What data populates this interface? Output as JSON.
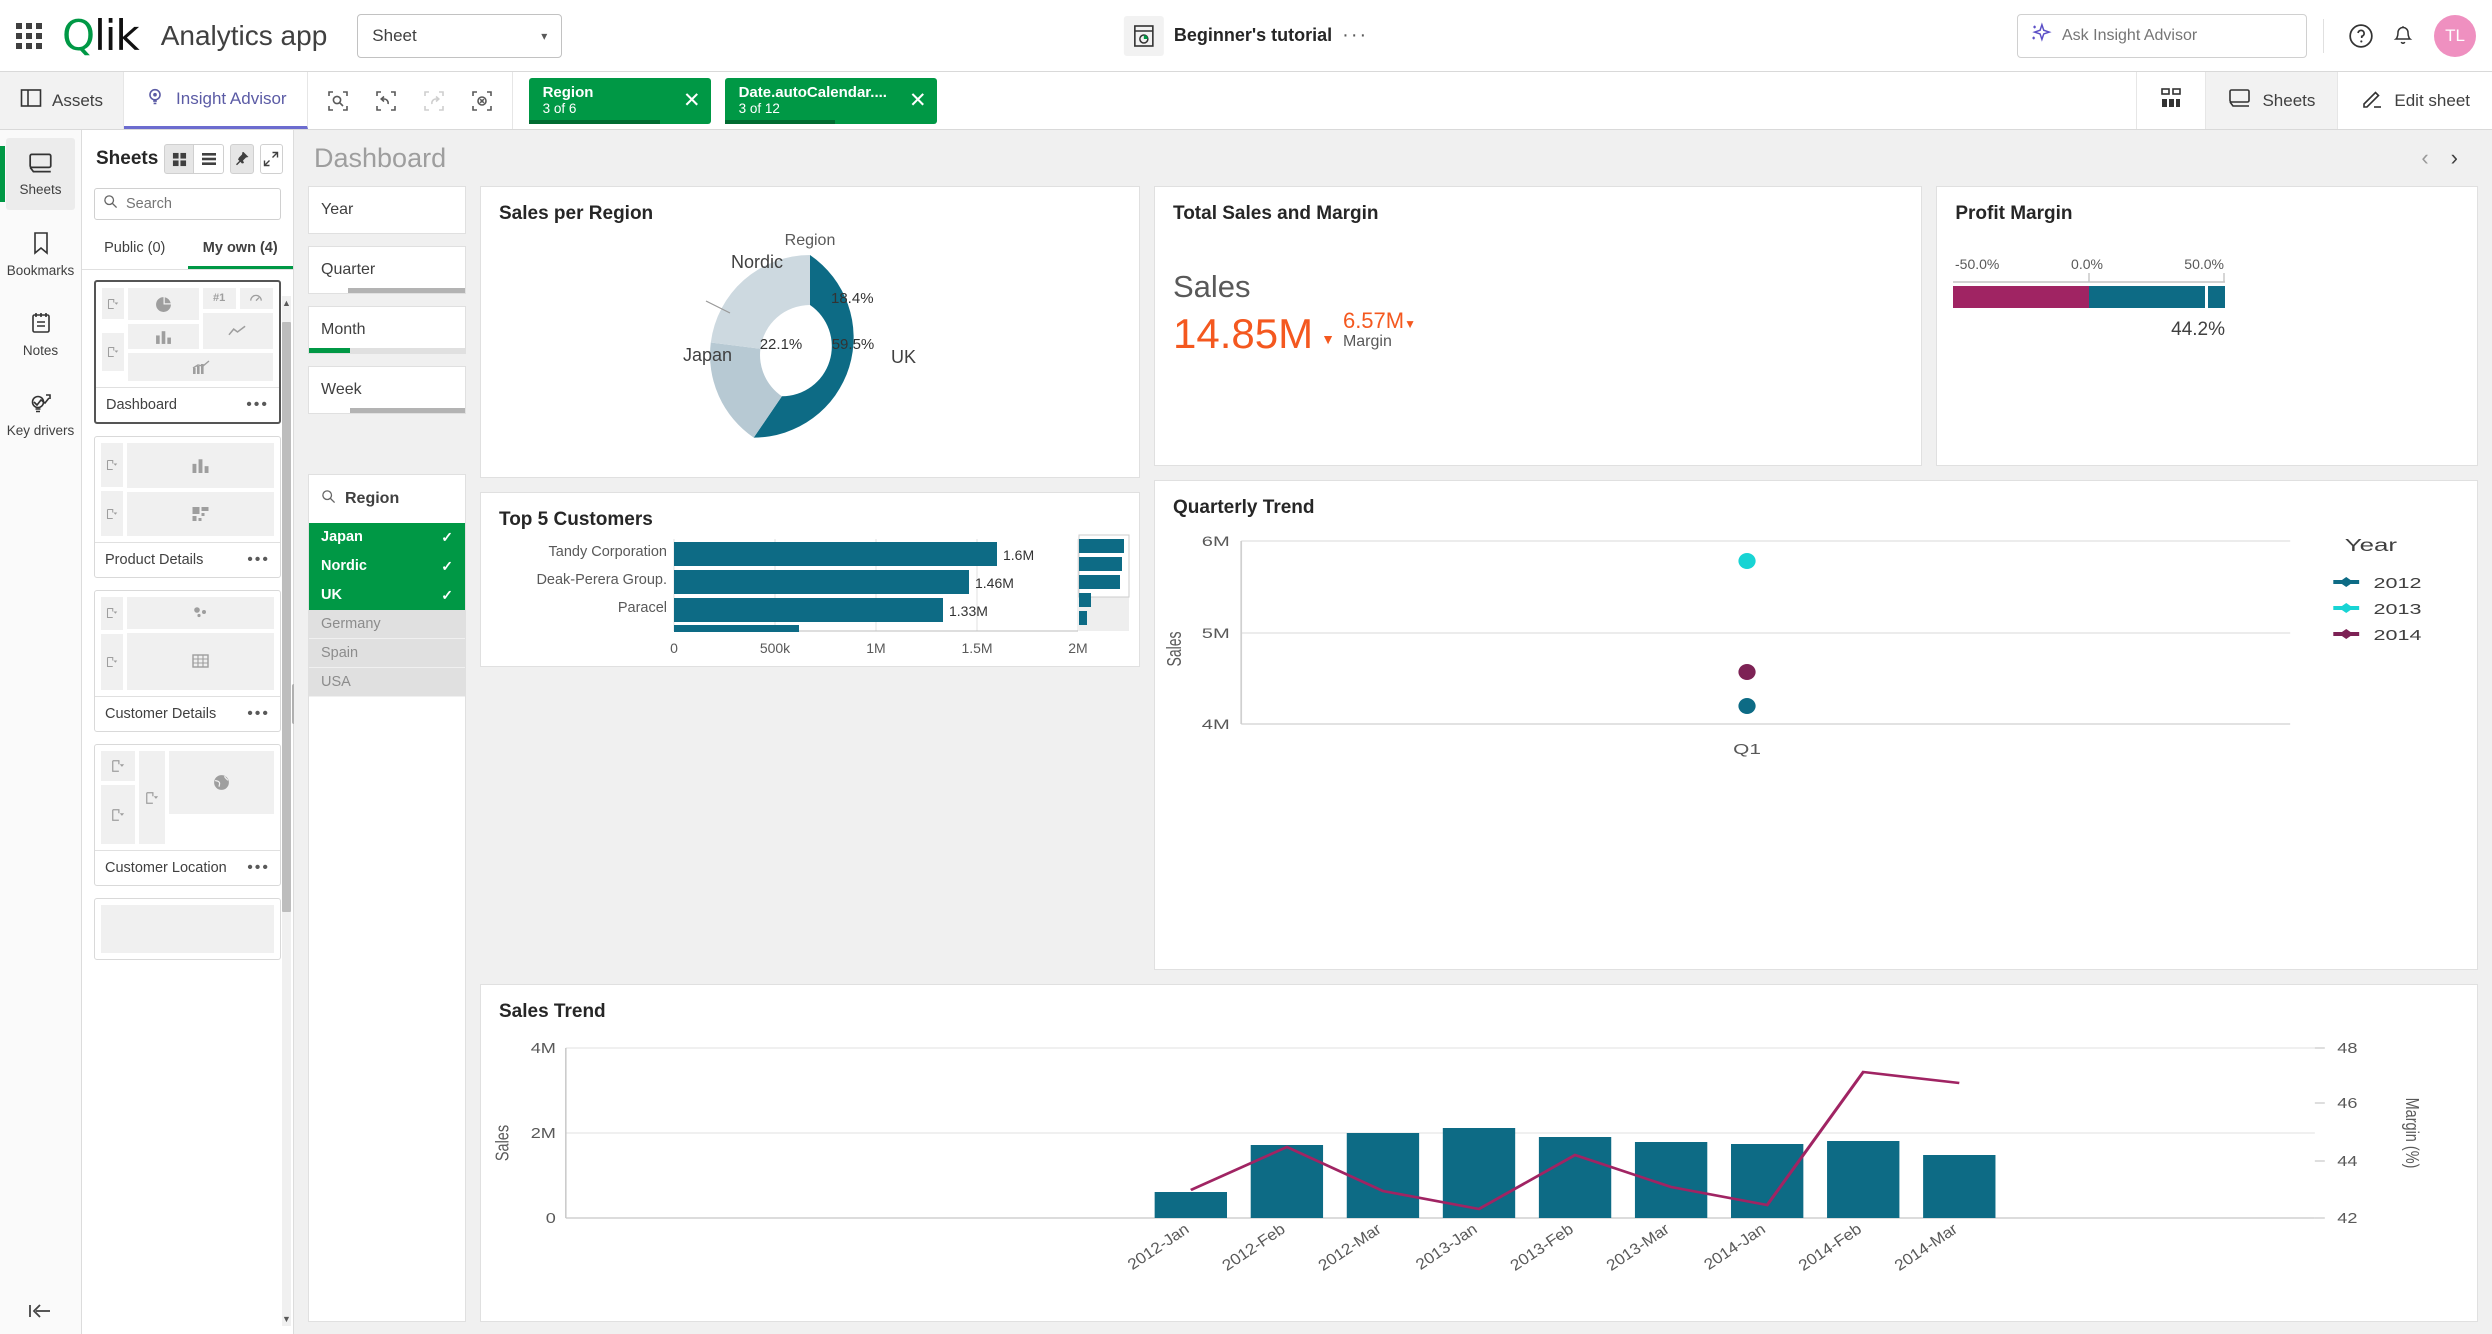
{
  "topbar": {
    "logo_text": "Qlik",
    "app_title": "Analytics app",
    "sheet_selector_value": "Sheet",
    "center_app_name": "Beginner's tutorial",
    "center_more": "···",
    "ask_placeholder": "Ask Insight Advisor",
    "avatar_initials": "TL",
    "help_icon": "help-icon",
    "bell_icon": "notifications-icon",
    "waffle_icon": "app-launcher-icon"
  },
  "toolbar": {
    "assets_label": "Assets",
    "insight_advisor_label": "Insight Advisor",
    "tools": [
      "selection-search-icon",
      "step-back-icon",
      "step-forward-icon",
      "clear-selections-icon"
    ],
    "chips": [
      {
        "field": "Region",
        "state": "3 of 6",
        "fill_pct": 72
      },
      {
        "field": "Date.autoCalendar....",
        "state": "3 of 12",
        "fill_pct": 52
      }
    ],
    "grid_view_label": "grid-view-icon",
    "sheets_label": "Sheets",
    "edit_sheet_label": "Edit sheet"
  },
  "rail": {
    "items": [
      {
        "label": "Sheets",
        "icon": "sheets-icon",
        "active": true
      },
      {
        "label": "Bookmarks",
        "icon": "bookmark-icon",
        "active": false
      },
      {
        "label": "Notes",
        "icon": "notes-icon",
        "active": false
      },
      {
        "label": "Key drivers",
        "icon": "key-drivers-icon",
        "active": false
      }
    ],
    "collapse_icon": "collapse-panel-icon"
  },
  "panel": {
    "title": "Sheets",
    "view_grid_icon": "grid-layout-icon",
    "view_list_icon": "list-layout-icon",
    "pin_icon": "pin-icon",
    "expand_icon": "expand-icon",
    "search_placeholder": "Search",
    "tabs": [
      {
        "label": "Public (0)",
        "active": false
      },
      {
        "label": "My own (4)",
        "active": true
      }
    ],
    "sheets": [
      {
        "name": "Dashboard",
        "active": true,
        "more": "•••"
      },
      {
        "name": "Product Details",
        "active": false,
        "more": "•••"
      },
      {
        "name": "Customer Details",
        "active": false,
        "more": "•••"
      },
      {
        "name": "Customer Location",
        "active": false,
        "more": "•••"
      }
    ]
  },
  "sheet": {
    "title": "Dashboard",
    "prev_arrow": "‹",
    "next_arrow": "›"
  },
  "filters": {
    "cards": [
      {
        "label": "Year",
        "fill_pct": 0,
        "fill_color": "#e8e8e8",
        "track_color": "#ffffff"
      },
      {
        "label": "Quarter",
        "fill_pct": 25,
        "fill_color": "#ffffff",
        "track_color": "#b3b3b3"
      },
      {
        "label": "Month",
        "fill_pct": 26,
        "fill_color": "#009845",
        "track_color": "#e0e0e0"
      },
      {
        "label": "Week",
        "fill_pct": 26,
        "fill_color": "#ffffff",
        "track_color": "#b3b3b3"
      }
    ],
    "listbox": {
      "title": "Region",
      "search_icon": "search-icon",
      "rows": [
        {
          "label": "Japan",
          "state": "selected",
          "check": "✓"
        },
        {
          "label": "Nordic",
          "state": "selected",
          "check": "✓"
        },
        {
          "label": "UK",
          "state": "selected",
          "check": "✓"
        },
        {
          "label": "Germany",
          "state": "alternative",
          "check": ""
        },
        {
          "label": "Spain",
          "state": "alternative",
          "check": ""
        },
        {
          "label": "USA",
          "state": "alternative",
          "check": ""
        }
      ]
    }
  },
  "kpi": {
    "title": "Total Sales and Margin",
    "measure_label": "Sales",
    "value": "14.85M",
    "caret": "▼",
    "secondary_value": "6.57M",
    "secondary_caret": "▼",
    "secondary_label": "Margin"
  },
  "chart_data": [
    {
      "id": "sales-per-region",
      "type": "pie",
      "title": "Sales per Region",
      "dimension_title": "Region",
      "labels": [
        "UK",
        "Japan",
        "Nordic"
      ],
      "values": [
        59.5,
        22.1,
        18.4
      ],
      "value_labels": [
        "59.5%",
        "22.1%",
        "18.4%"
      ],
      "colors": [
        "#0d6b85",
        "#b7c9d3",
        "#cdd9e0"
      ],
      "donut": true
    },
    {
      "id": "top-5-customers",
      "type": "bar",
      "title": "Top 5 Customers",
      "orientation": "horizontal",
      "categories": [
        "Tandy Corporation",
        "Deak-Perera Group.",
        "Paracel",
        ""
      ],
      "values": [
        1600000,
        1460000,
        1330000,
        620000
      ],
      "data_labels": [
        "1.6M",
        "1.46M",
        "1.33M",
        ""
      ],
      "xticks": [
        "0",
        "500k",
        "1M",
        "1.5M",
        "2M"
      ],
      "xlim": [
        0,
        2000000
      ],
      "color": "#0d6b85",
      "has_minimap": true,
      "minimap_values": [
        1600000,
        1460000,
        1330000,
        620000,
        450000
      ]
    },
    {
      "id": "profit-margin",
      "type": "bullet",
      "title": "Profit Margin",
      "axis_ticks": [
        "-50.0%",
        "0.0%",
        "50.0%"
      ],
      "xlim": [
        -50,
        50
      ],
      "value": 44.2,
      "value_label": "44.2%",
      "negative_color": "#a02463",
      "positive_color": "#0d6b85",
      "marker": 44.2
    },
    {
      "id": "quarterly-trend",
      "type": "scatter",
      "title": "Quarterly Trend",
      "xlabel": "",
      "ylabel": "Sales",
      "xticks": [
        "Q1"
      ],
      "yticks": [
        "4M",
        "5M",
        "6M"
      ],
      "ylim": [
        4000000,
        6000000
      ],
      "legend_title": "Year",
      "legend_position": "right",
      "series": [
        {
          "name": "2012",
          "color": "#0d6b85",
          "points": [
            {
              "x": "Q1",
              "y": 4460000
            }
          ]
        },
        {
          "name": "2013",
          "color": "#18d4d4",
          "points": [
            {
              "x": "Q1",
              "y": 5790000
            }
          ]
        },
        {
          "name": "2014",
          "color": "#7d2255",
          "points": [
            {
              "x": "Q1",
              "y": 4640000
            }
          ]
        }
      ]
    },
    {
      "id": "sales-trend",
      "type": "bar",
      "title": "Sales Trend",
      "categories": [
        "2012-Jan",
        "2012-Feb",
        "2012-Mar",
        "2013-Jan",
        "2013-Feb",
        "2013-Mar",
        "2014-Jan",
        "2014-Feb",
        "2014-Mar"
      ],
      "ylabel": "Sales",
      "yticks": [
        "0",
        "2M",
        "4M"
      ],
      "ylim": [
        0,
        4000000
      ],
      "bar_values": [
        620000,
        1710000,
        2000000,
        2130000,
        1900000,
        1790000,
        1740000,
        1810000,
        1480000
      ],
      "bar_color": "#0d6b85",
      "secondary_ylabel": "Margin (%)",
      "secondary_yticks": [
        "42",
        "44",
        "46",
        "48"
      ],
      "secondary_ylim": [
        42,
        48
      ],
      "line_name": "Margin",
      "line_color": "#a02463",
      "line_values": [
        43.0,
        45.8,
        44.0,
        42.5,
        45.5,
        43.7,
        42.8,
        47.3,
        46.9
      ]
    }
  ]
}
